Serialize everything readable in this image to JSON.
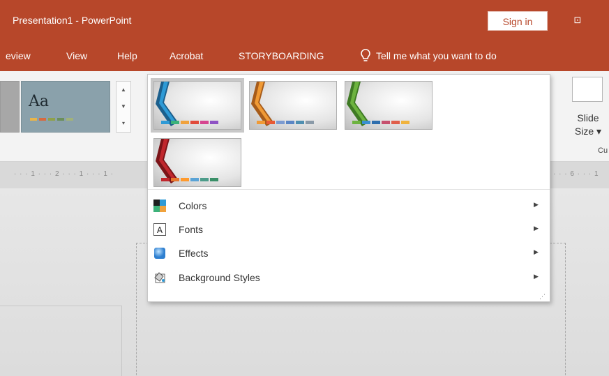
{
  "window": {
    "title": "Presentation1  -  PowerPoint",
    "sign_in": "Sign in",
    "ribbon_display_icon": "restore-window-icon"
  },
  "tabs": [
    {
      "label": "eview"
    },
    {
      "label": "View"
    },
    {
      "label": "Help"
    },
    {
      "label": "Acrobat"
    },
    {
      "label": "STORYBOARDING"
    }
  ],
  "tell_me": {
    "label": "Tell me what you want to do"
  },
  "ribbon": {
    "theme_preview_text": "Aa",
    "slide_size_label": "Slide Size",
    "slide_size_caret": "▾",
    "group_label_fragment": "Cu"
  },
  "ruler": {
    "left": "· · · 1 · · · 2 · · · 1 · · · 1 ·",
    "right": "· · · 6 · · · 1"
  },
  "variants": [
    {
      "stripe_main": "#2e9ad6",
      "stripe_alt": "#1c5f8c",
      "dots": [
        "#2e9ad6",
        "#3cb27a",
        "#f0a23d",
        "#e14b3b",
        "#d6458f",
        "#8e52c4"
      ]
    },
    {
      "stripe_main": "#f09a35",
      "stripe_alt": "#a65b1a",
      "dots": [
        "#f09a35",
        "#e85a35",
        "#7c9bd1",
        "#5b86c5",
        "#4f8fb1",
        "#8a9aa8"
      ]
    },
    {
      "stripe_main": "#6db33f",
      "stripe_alt": "#3f7a24",
      "dots": [
        "#6db33f",
        "#3a8fd1",
        "#2f6fae",
        "#c6506e",
        "#e05f4b",
        "#f0b33d"
      ]
    },
    {
      "stripe_main": "#c0272d",
      "stripe_alt": "#7a1418",
      "dots": [
        "#c0272d",
        "#e6762c",
        "#ff9a2d",
        "#5aa3d6",
        "#4d9c8a",
        "#3a8f68"
      ]
    }
  ],
  "menu": [
    {
      "label": "Colors",
      "icon": "colors-icon"
    },
    {
      "label": "Fonts",
      "icon": "fonts-icon"
    },
    {
      "label": "Effects",
      "icon": "effects-icon"
    },
    {
      "label": "Background Styles",
      "icon": "background-styles-icon"
    }
  ]
}
